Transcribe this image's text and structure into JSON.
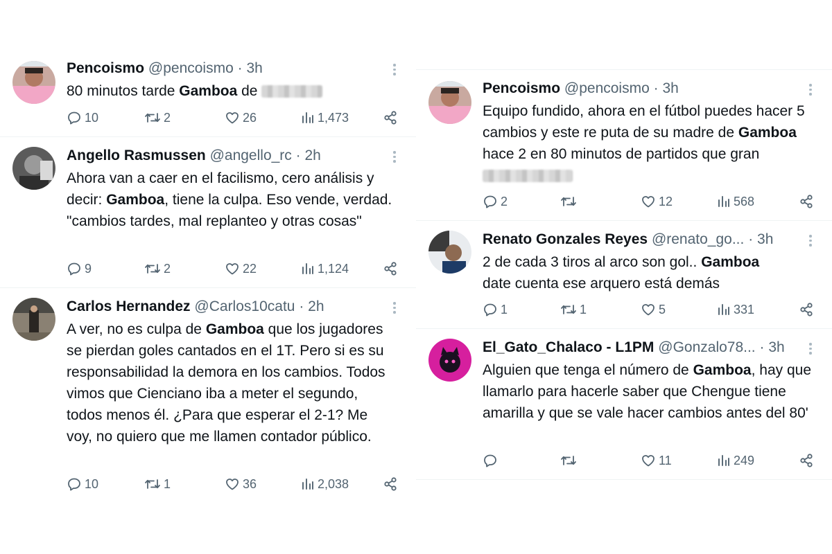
{
  "left": [
    {
      "name": "Pencoismo",
      "handle": "@pencoismo",
      "time": "3h",
      "text_parts": [
        "80 minutos tarde ",
        "Gamboa",
        " de"
      ],
      "replies": "10",
      "retweets": "2",
      "likes": "26",
      "views": "1,473"
    },
    {
      "name": "Angello Rasmussen",
      "handle": "@angello_rc",
      "time": "2h",
      "text_parts": [
        "Ahora van a caer en el facilismo, cero análisis y decir: ",
        "Gamboa",
        ", tiene la culpa. Eso vende, verdad.",
        "\"cambios tardes, mal replanteo y otras cosas\""
      ],
      "replies": "9",
      "retweets": "2",
      "likes": "22",
      "views": "1,124"
    },
    {
      "name": "Carlos Hernandez",
      "handle": "@Carlos10catu",
      "time": "2h",
      "text_parts": [
        "A ver, no es culpa de ",
        "Gamboa",
        " que los jugadores se pierdan goles cantados en el 1T. Pero si es su responsabilidad la demora en los cambios. Todos vimos que Cienciano iba a meter el segundo, todos menos él. ¿Para que esperar el 2-1? Me voy, no quiero que me llamen contador público."
      ],
      "replies": "10",
      "retweets": "1",
      "likes": "36",
      "views": "2,038"
    }
  ],
  "right": [
    {
      "name": "Pencoismo",
      "handle": "@pencoismo",
      "time": "3h",
      "text_parts": [
        "Equipo fundido,  ahora en el fútbol puedes hacer 5 cambios y este re puta de su madre de ",
        "Gamboa",
        " hace 2 en 80 minutos de partidos que gran"
      ],
      "replies": "2",
      "retweets": "",
      "likes": "12",
      "views": "568"
    },
    {
      "name": "Renato Gonzales Reyes",
      "handle": "@renato_go...",
      "time": "3h",
      "text_parts": [
        "2 de cada 3 tiros al arco son gol.. ",
        "Gamboa",
        " date cuenta ese arquero está demás"
      ],
      "replies": "1",
      "retweets": "1",
      "likes": "5",
      "views": "331"
    },
    {
      "name": "El_Gato_Chalaco - L1PM",
      "handle": "@Gonzalo78...",
      "time": "3h",
      "text_parts": [
        "Alguien que tenga el número de ",
        "Gamboa",
        ", hay que llamarlo para hacerle saber que Chengue tiene amarilla y que se vale hacer cambios antes del 80'"
      ],
      "replies": "",
      "retweets": "",
      "likes": "11",
      "views": "249"
    }
  ],
  "sep": "·",
  "colors": {
    "text": "#0f1419",
    "muted": "#536471",
    "divider": "#eff3f4"
  },
  "icons": [
    "reply-icon",
    "retweet-icon",
    "like-icon",
    "views-icon",
    "share-icon",
    "more-icon"
  ]
}
